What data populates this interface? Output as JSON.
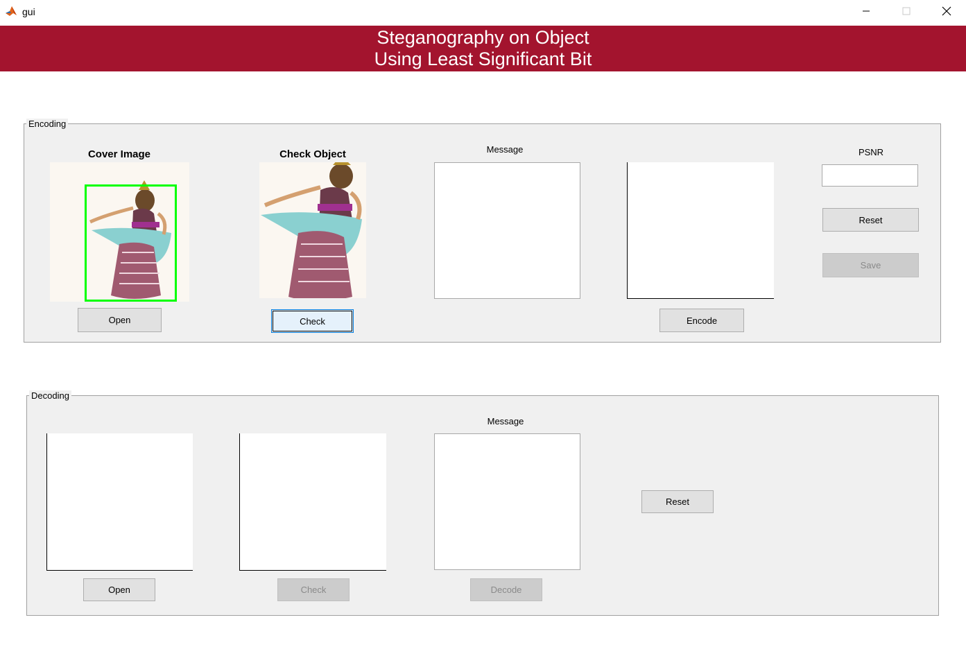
{
  "window": {
    "title": "gui"
  },
  "banner": {
    "line1": "Steganography on Object",
    "line2": "Using Least Significant Bit"
  },
  "encoding": {
    "legend": "Encoding",
    "cover_image_label": "Cover Image",
    "check_object_label": "Check Object",
    "message_label": "Message",
    "psnr_label": "PSNR",
    "psnr_value": "",
    "open_button": "Open",
    "check_button": "Check",
    "encode_button": "Encode",
    "reset_button": "Reset",
    "save_button": "Save"
  },
  "decoding": {
    "legend": "Decoding",
    "message_label": "Message",
    "open_button": "Open",
    "check_button": "Check",
    "decode_button": "Decode",
    "reset_button": "Reset"
  },
  "colors": {
    "banner": "#a3142e",
    "detection_box": "#00ff00",
    "panel": "#f0f0f0"
  },
  "icons": {
    "app": "matlab-icon",
    "minimize": "minimize-icon",
    "maximize": "maximize-icon",
    "close": "close-icon"
  }
}
